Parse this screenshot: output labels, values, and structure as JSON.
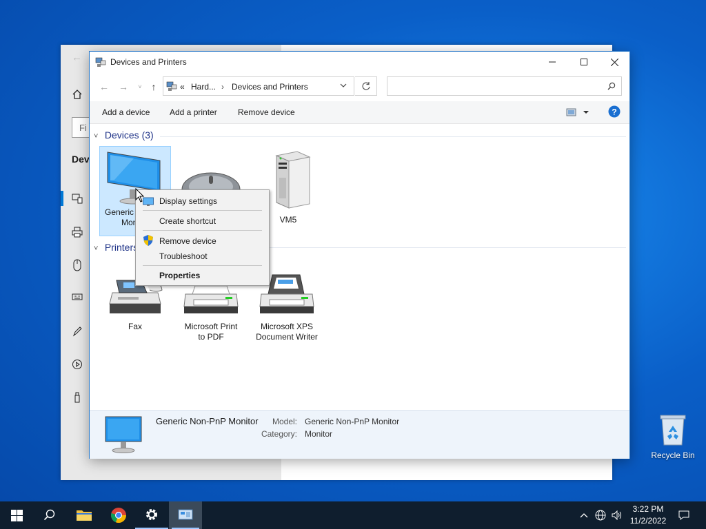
{
  "desktop": {
    "recycle_bin_label": "Recycle Bin"
  },
  "settings_window": {
    "search_placeholder": "Fi",
    "devices_heading": "Devi"
  },
  "window": {
    "title": "Devices and Printers",
    "breadcrumb": {
      "overflow": "«",
      "parent": "Hard...",
      "current": "Devices and Printers"
    },
    "search_placeholder": ""
  },
  "commands": {
    "add_device": "Add a device",
    "add_printer": "Add a printer",
    "remove_device": "Remove device"
  },
  "groups": {
    "devices": {
      "title": "Devices (3)"
    },
    "printers": {
      "title": "Printers"
    }
  },
  "devices": [
    {
      "line1": "Generic",
      "line2": "Mon"
    },
    {
      "line1": ""
    },
    {
      "line1": "VM5"
    }
  ],
  "printers": [
    {
      "line1": "Fax",
      "line2": ""
    },
    {
      "line1": "Microsoft Print",
      "line2": "to PDF"
    },
    {
      "line1": "Microsoft XPS",
      "line2": "Document Writer"
    }
  ],
  "details": {
    "name": "Generic Non-PnP Monitor",
    "model_label": "Model:",
    "model_value": "Generic Non-PnP Monitor",
    "category_label": "Category:",
    "category_value": "Monitor"
  },
  "context_menu": {
    "display_settings": "Display settings",
    "create_shortcut": "Create shortcut",
    "remove_device": "Remove device",
    "troubleshoot": "Troubleshoot",
    "properties": "Properties"
  },
  "taskbar": {
    "time": "3:22 PM",
    "date": "11/2/2022"
  },
  "colors": {
    "accent": "#0078d4",
    "selection": "#cce8ff",
    "taskbar": "#0f1e2e",
    "help": "#1a6fd1"
  }
}
